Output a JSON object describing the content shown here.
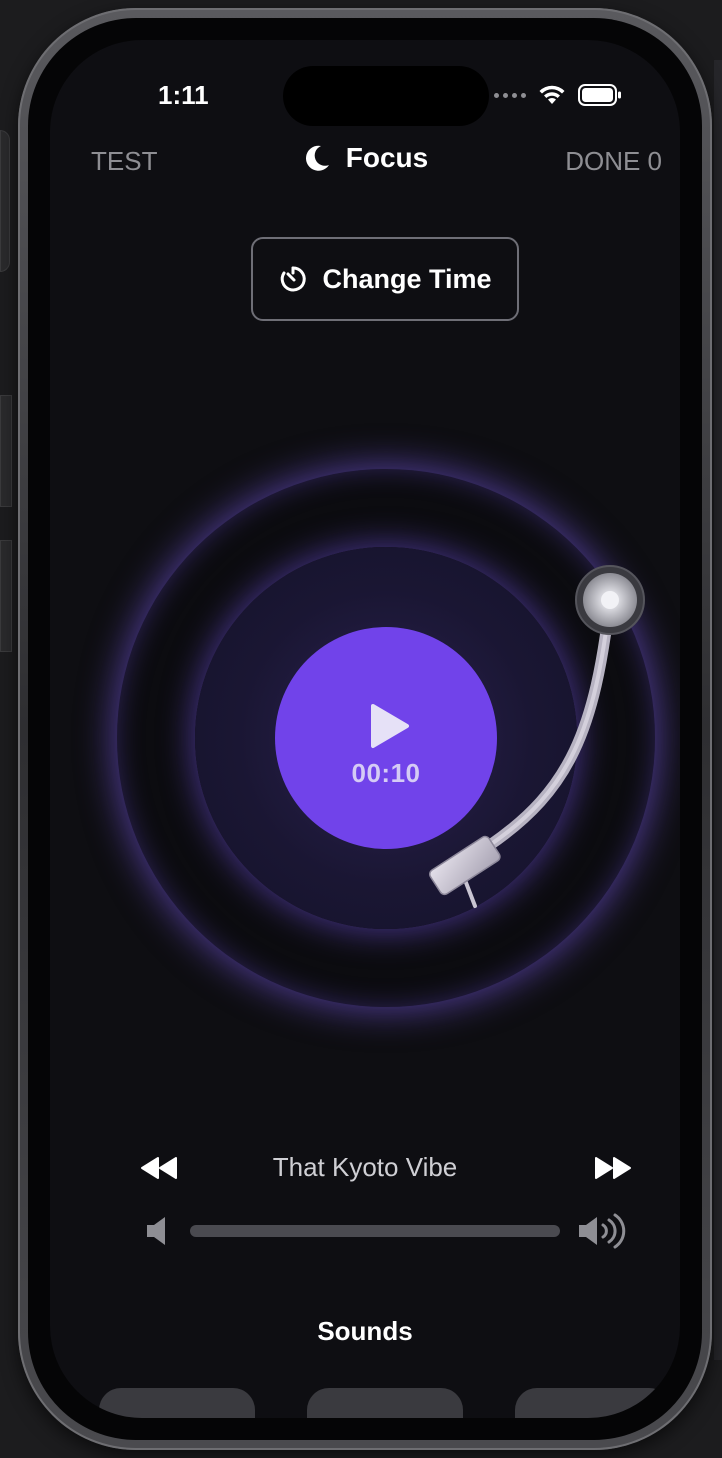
{
  "status_bar": {
    "time": "1:11"
  },
  "nav": {
    "left_label": "TEST",
    "title": "Focus",
    "right_label": "DONE 0"
  },
  "change_time": {
    "label": "Change Time"
  },
  "player": {
    "timer": "00:10",
    "track_title": "That Kyoto Vibe",
    "volume_level": 0.0
  },
  "sounds": {
    "label": "Sounds"
  },
  "colors": {
    "accent": "#7143ea",
    "background": "#0e0e12",
    "glow": "#7a5ae6"
  },
  "icons": {
    "title": "moon-icon",
    "change_time": "timer-icon",
    "play": "play-icon",
    "rewind": "rewind-icon",
    "fast_forward": "fast-forward-icon",
    "volume_low": "volume-low-icon",
    "volume_high": "volume-high-icon"
  }
}
